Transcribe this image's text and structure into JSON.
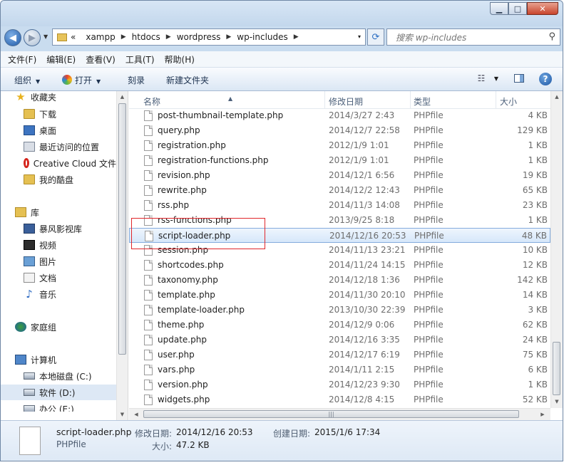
{
  "window": {
    "controls": {
      "minimize": "▁",
      "maximize": "□",
      "close": "✕"
    }
  },
  "address": {
    "overflow": "«",
    "crumbs": [
      "xampp",
      "htdocs",
      "wordpress",
      "wp-includes"
    ],
    "dropdown": "▾",
    "refresh": "⟳"
  },
  "search": {
    "placeholder": "搜索 wp-includes"
  },
  "menu": [
    "文件(F)",
    "编辑(E)",
    "查看(V)",
    "工具(T)",
    "帮助(H)"
  ],
  "toolbar": {
    "organize": "组织",
    "open": "打开",
    "burn": "刻录",
    "new_folder": "新建文件夹",
    "help": "?"
  },
  "nav": [
    {
      "label": "收藏夹",
      "icon": "star-icon"
    },
    {
      "label": "下载",
      "icon": "download-folder-icon"
    },
    {
      "label": "桌面",
      "icon": "desktop-icon"
    },
    {
      "label": "最近访问的位置",
      "icon": "recent-places-icon"
    },
    {
      "label": "Creative Cloud 文件",
      "icon": "creative-cloud-icon"
    },
    {
      "label": "我的酷盘",
      "icon": "kupan-folder-icon"
    },
    {
      "label": "库",
      "icon": "library-icon"
    },
    {
      "label": "暴风影视库",
      "icon": "video-library-icon"
    },
    {
      "label": "视频",
      "icon": "video-icon"
    },
    {
      "label": "图片",
      "icon": "pictures-icon"
    },
    {
      "label": "文档",
      "icon": "documents-icon"
    },
    {
      "label": "音乐",
      "icon": "music-icon"
    },
    {
      "label": "家庭组",
      "icon": "homegroup-icon"
    },
    {
      "label": "计算机",
      "icon": "computer-icon"
    },
    {
      "label": "本地磁盘 (C:)",
      "icon": "drive-c-icon"
    },
    {
      "label": "软件 (D:)",
      "icon": "drive-d-icon"
    },
    {
      "label": "办公 (E:)",
      "icon": "drive-e-icon"
    }
  ],
  "columns": {
    "name": "名称",
    "date": "修改日期",
    "type": "类型",
    "size": "大小"
  },
  "files": [
    {
      "name": "post-thumbnail-template.php",
      "date": "2014/3/27 2:43",
      "type": "PHPfile",
      "size": "4 KB"
    },
    {
      "name": "query.php",
      "date": "2014/12/7 22:58",
      "type": "PHPfile",
      "size": "129 KB"
    },
    {
      "name": "registration.php",
      "date": "2012/1/9 1:01",
      "type": "PHPfile",
      "size": "1 KB"
    },
    {
      "name": "registration-functions.php",
      "date": "2012/1/9 1:01",
      "type": "PHPfile",
      "size": "1 KB"
    },
    {
      "name": "revision.php",
      "date": "2014/12/1 6:56",
      "type": "PHPfile",
      "size": "19 KB"
    },
    {
      "name": "rewrite.php",
      "date": "2014/12/2 12:43",
      "type": "PHPfile",
      "size": "65 KB"
    },
    {
      "name": "rss.php",
      "date": "2014/11/3 14:08",
      "type": "PHPfile",
      "size": "23 KB"
    },
    {
      "name": "rss-functions.php",
      "date": "2013/9/25 8:18",
      "type": "PHPfile",
      "size": "1 KB"
    },
    {
      "name": "script-loader.php",
      "date": "2014/12/16 20:53",
      "type": "PHPfile",
      "size": "48 KB"
    },
    {
      "name": "session.php",
      "date": "2014/11/13 23:21",
      "type": "PHPfile",
      "size": "10 KB"
    },
    {
      "name": "shortcodes.php",
      "date": "2014/11/24 14:15",
      "type": "PHPfile",
      "size": "12 KB"
    },
    {
      "name": "taxonomy.php",
      "date": "2014/12/18 1:36",
      "type": "PHPfile",
      "size": "142 KB"
    },
    {
      "name": "template.php",
      "date": "2014/11/30 20:10",
      "type": "PHPfile",
      "size": "14 KB"
    },
    {
      "name": "template-loader.php",
      "date": "2013/10/30 22:39",
      "type": "PHPfile",
      "size": "3 KB"
    },
    {
      "name": "theme.php",
      "date": "2014/12/9 0:06",
      "type": "PHPfile",
      "size": "62 KB"
    },
    {
      "name": "update.php",
      "date": "2014/12/16 3:35",
      "type": "PHPfile",
      "size": "24 KB"
    },
    {
      "name": "user.php",
      "date": "2014/12/17 6:19",
      "type": "PHPfile",
      "size": "75 KB"
    },
    {
      "name": "vars.php",
      "date": "2014/1/11 2:15",
      "type": "PHPfile",
      "size": "6 KB"
    },
    {
      "name": "version.php",
      "date": "2014/12/23 9:30",
      "type": "PHPfile",
      "size": "1 KB"
    },
    {
      "name": "widgets.php",
      "date": "2014/12/8 4:15",
      "type": "PHPfile",
      "size": "52 KB"
    }
  ],
  "selected_index": 8,
  "details": {
    "filename": "script-loader.php",
    "filetype": "PHPfile",
    "modified_label": "修改日期:",
    "modified_value": "2014/12/16 20:53",
    "created_label": "创建日期:",
    "created_value": "2015/1/6 17:34",
    "size_label": "大小:",
    "size_value": "47.2 KB"
  },
  "colors": {
    "accent": "#3c7fb1",
    "selection": "#d6e7fa",
    "highlight_box": "#e0262b"
  }
}
